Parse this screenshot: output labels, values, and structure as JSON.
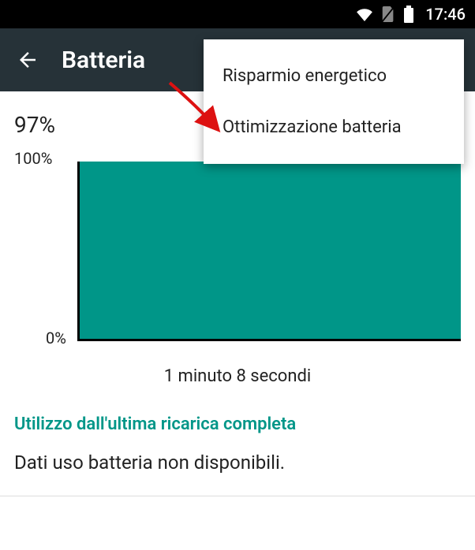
{
  "status_bar": {
    "time": "17:46"
  },
  "app_bar": {
    "title": "Batteria"
  },
  "battery": {
    "percent_label": "97%"
  },
  "menu": {
    "item1": "Risparmio energetico",
    "item2": "Ottimizzazione batteria"
  },
  "section": {
    "since_title": "Utilizzo dall'ultima ricarica completa",
    "no_data": "Dati uso batteria non disponibili."
  },
  "chart_data": {
    "type": "area",
    "x": [
      0,
      68
    ],
    "series": [
      {
        "name": "battery",
        "values": [
          100,
          97
        ]
      }
    ],
    "xlabel": "1 minuto 8 secondi",
    "ylabel": "",
    "ylim": [
      0,
      100
    ],
    "yticks": {
      "top": "100%",
      "bottom": "0%"
    }
  }
}
